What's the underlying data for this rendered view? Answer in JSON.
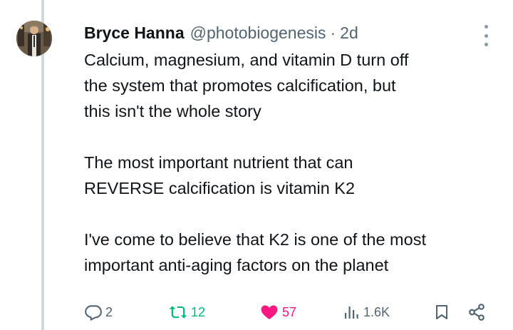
{
  "tweet": {
    "author_name": "Bryce Hanna",
    "handle": "@photobiogenesis",
    "separator": "·",
    "time": "2d",
    "paragraphs": [
      "Calcium, magnesium, and vitamin D turn off\nthe system that promotes calcification, but\nthis isn't the whole story",
      "The most important nutrient that can\nREVERSE calcification is vitamin K2",
      "I've come to believe that K2 is one of the most\nimportant anti-aging factors on the planet"
    ]
  },
  "actions": {
    "replies": "2",
    "reposts": "12",
    "likes": "57",
    "views": "1.6K"
  },
  "icons": {
    "reply": "reply-icon",
    "repost": "repost-icon",
    "like": "heart-icon",
    "views": "views-icon",
    "bookmark": "bookmark-icon",
    "share": "share-icon",
    "more": "more-options-icon"
  },
  "colors": {
    "text": "#0f1419",
    "secondary": "#536471",
    "repost_green": "#00ba7c",
    "like_pink": "#f91880",
    "thread_line": "#cfd9de"
  }
}
